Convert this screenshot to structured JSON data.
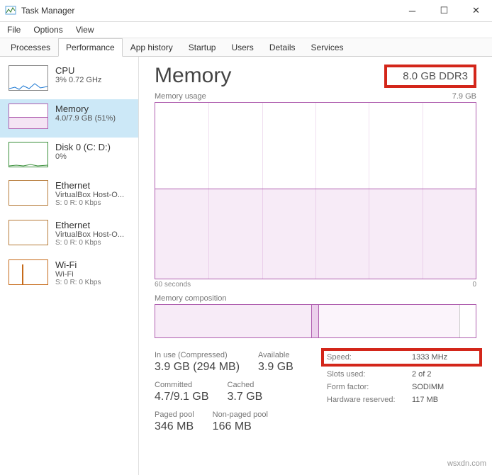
{
  "window": {
    "title": "Task Manager"
  },
  "menu": {
    "file": "File",
    "options": "Options",
    "view": "View"
  },
  "tabs": {
    "processes": "Processes",
    "performance": "Performance",
    "app_history": "App history",
    "startup": "Startup",
    "users": "Users",
    "details": "Details",
    "services": "Services"
  },
  "sidebar": {
    "cpu": {
      "title": "CPU",
      "sub": "3% 0.72 GHz"
    },
    "memory": {
      "title": "Memory",
      "sub": "4.0/7.9 GB (51%)"
    },
    "disk": {
      "title": "Disk 0 (C: D:)",
      "sub": "0%"
    },
    "eth1": {
      "title": "Ethernet",
      "sub": "VirtualBox Host-O...",
      "sub2": "S: 0 R: 0 Kbps"
    },
    "eth2": {
      "title": "Ethernet",
      "sub": "VirtualBox Host-O...",
      "sub2": "S: 0 R: 0 Kbps"
    },
    "wifi": {
      "title": "Wi-Fi",
      "sub": "Wi-Fi",
      "sub2": "S: 0 R: 0 Kbps"
    }
  },
  "main": {
    "title": "Memory",
    "capacity": "8.0 GB DDR3",
    "usage_label": "Memory usage",
    "usage_max": "7.9 GB",
    "axis_left": "60 seconds",
    "axis_right": "0",
    "comp_label": "Memory composition",
    "stats": {
      "inuse_k": "In use (Compressed)",
      "inuse_v": "3.9 GB (294 MB)",
      "avail_k": "Available",
      "avail_v": "3.9 GB",
      "committed_k": "Committed",
      "committed_v": "4.7/9.1 GB",
      "cached_k": "Cached",
      "cached_v": "3.7 GB",
      "paged_k": "Paged pool",
      "paged_v": "346 MB",
      "nonpaged_k": "Non-paged pool",
      "nonpaged_v": "166 MB"
    },
    "kv": {
      "speed_k": "Speed:",
      "speed_v": "1333 MHz",
      "slots_k": "Slots used:",
      "slots_v": "2 of 2",
      "form_k": "Form factor:",
      "form_v": "SODIMM",
      "hw_k": "Hardware reserved:",
      "hw_v": "117 MB"
    }
  },
  "watermark": "wsxdn.com",
  "chart_data": {
    "type": "area",
    "title": "Memory usage",
    "ylabel": "GB",
    "ylim": [
      0,
      7.9
    ],
    "x_seconds": [
      60,
      0
    ],
    "series": [
      {
        "name": "In use",
        "approx_value_gb": 4.0,
        "percent": 51
      }
    ],
    "composition_percent": {
      "in_use": 49,
      "modified": 2,
      "standby": 44,
      "free": 5
    }
  }
}
